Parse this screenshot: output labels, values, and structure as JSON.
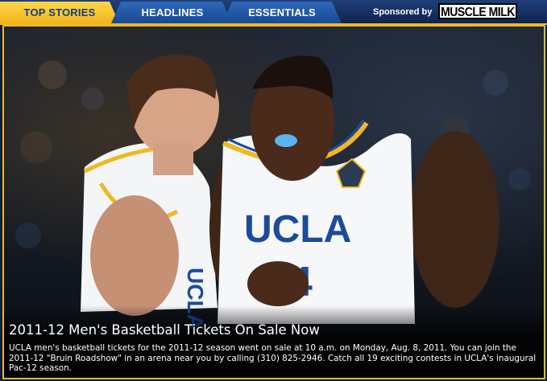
{
  "tabs": [
    {
      "label": "TOP STORIES",
      "active": true
    },
    {
      "label": "HEADLINES",
      "active": false
    },
    {
      "label": "ESSENTIALS",
      "active": false
    }
  ],
  "sponsor": {
    "label": "Sponsored by",
    "logo_text": "MUSCLE MILK"
  },
  "story": {
    "headline": "2011-12 Men's Basketball Tickets On Sale Now",
    "summary": "UCLA men's basketball tickets for the 2011-12 season went on sale at 10 a.m. on Monday, Aug. 8, 2011. You can join the 2011-12 \"Bruin Roadshow\" in an arena near you by calling (310) 825-2946. Catch all 19 exciting contests in UCLA's inaugural Pac-12 season.",
    "photo": {
      "jersey_text": "UCLA",
      "jersey_number": "34",
      "side_player_jersey_text": "UCLA"
    }
  },
  "colors": {
    "accent_gold": "#f1b724",
    "navy": "#0f3d86",
    "tab_blue": "#174a94"
  }
}
